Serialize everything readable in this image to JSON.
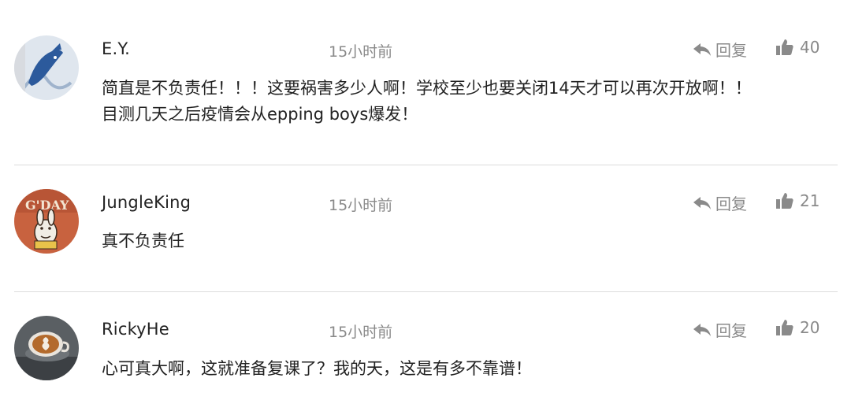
{
  "comments": [
    {
      "username": "E.Y.",
      "time": "15小时前",
      "reply_label": "回复",
      "likes": "40",
      "text": "简直是不负责任！！！这要祸害多少人啊！学校至少也要关闭14天才可以再次开放啊！！\n目测几天之后疫情会从epping boys爆发！",
      "avatar_icon": "whale-painting-avatar"
    },
    {
      "username": "JungleKing",
      "time": "15小时前",
      "reply_label": "回复",
      "likes": "21",
      "text": "真不负责任",
      "avatar_icon": "gday-cartoon-avatar"
    },
    {
      "username": "RickyHe",
      "time": "15小时前",
      "reply_label": "回复",
      "likes": "20",
      "text": "心可真大啊，这就准备复课了？我的天，这是有多不靠谱！",
      "avatar_icon": "latte-art-avatar"
    }
  ],
  "icons": {
    "reply": "reply-arrow-icon",
    "like": "thumbs-up-icon"
  },
  "colors": {
    "text": "#222222",
    "muted": "#8a8a8a",
    "divider": "#dcdcdc"
  }
}
